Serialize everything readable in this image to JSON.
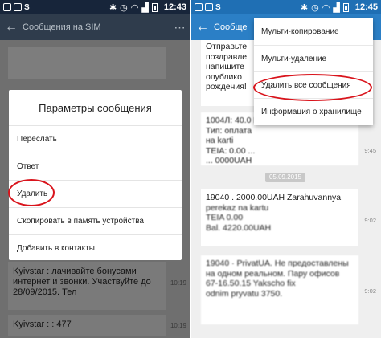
{
  "left": {
    "status": {
      "time": "12:43",
      "signal_icon": "signal-icon",
      "wifi_icon": "wifi-icon",
      "battery_icon": "battery-icon"
    },
    "header": {
      "title": "Сообщения на SIM"
    },
    "dialog": {
      "title": "Параметры сообщения",
      "items": [
        "Переслать",
        "Ответ",
        "Удалить",
        "Скопировать в память устройства",
        "Добавить в контакты"
      ]
    },
    "messages": [
      {
        "text": "Kyivstar : лачивайте бонусами интернет и звонки. Участвуйте до 28/09/2015. Тел",
        "time": "10:19"
      },
      {
        "text": "Kyivstar : : 477",
        "time": "10:19"
      }
    ]
  },
  "right": {
    "status": {
      "time": "12:45"
    },
    "header": {
      "title": "Сообще"
    },
    "menu": {
      "items": [
        "Мульти-копирование",
        "Мульти-удаление",
        "Удалить все сообщения",
        "Информация о хранилище"
      ]
    },
    "messages": [
      {
        "lines": [
          "Отправьте",
          "поздравле",
          "напишите",
          "опублико",
          "рождения!"
        ]
      },
      {
        "lines": [
          "1004Л: 40.0 Перевод",
          "Тип: оплата",
          "на karti",
          "TEIA: 0.00 ... ",
          "... 0000UAH"
        ],
        "time": "9:45"
      },
      {
        "lines": [
          "19040 . 2000.00UAH Zarahuvannya",
          "perekaz na kartu",
          "TEIA 0.00",
          "Bal. 4220.00UAH"
        ],
        "time": "9:02"
      },
      {
        "lines": [
          "19040 · PrivatUA. Не предоставлены",
          "на одном реальном. Пару офисов",
          "67-16.50.15 Yakscho fix ",
          "odnim pryvatu 3750."
        ],
        "time": "9:02"
      }
    ],
    "date_badge": "05.09.2015"
  },
  "colors": {
    "accent_blue": "#2b7fc6",
    "highlight_red": "#d9141c"
  }
}
